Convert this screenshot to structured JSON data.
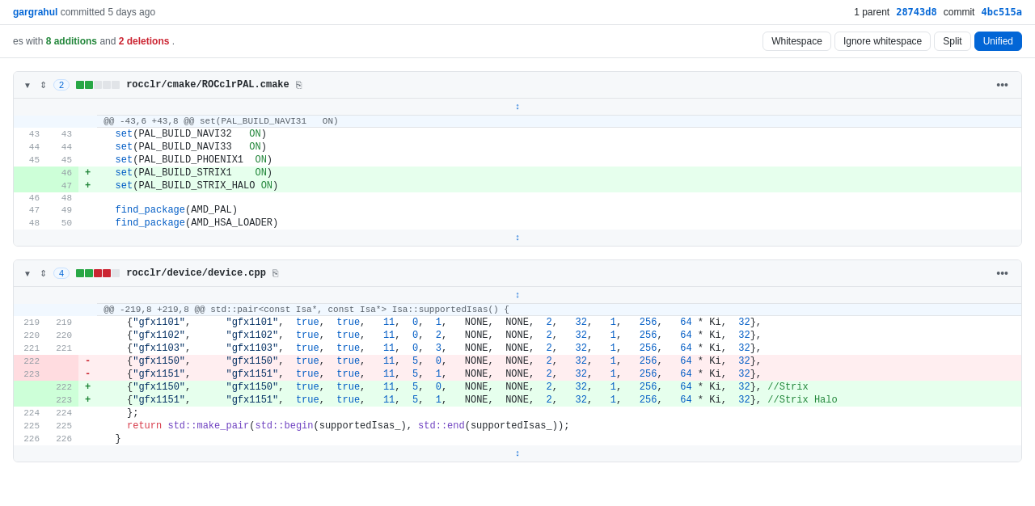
{
  "header": {
    "user": "gargrahul",
    "action": "committed",
    "time": "5 days ago",
    "parent_label": "1 parent",
    "parent_hash": "28743d8",
    "commit_label": "commit",
    "commit_hash": "4bc515a"
  },
  "stats": {
    "text": "es with",
    "additions": "8 additions",
    "and": "and",
    "deletions": "2 deletions",
    "period": "."
  },
  "view_buttons": {
    "whitespace": "Whitespace",
    "ignore_whitespace": "Ignore whitespace",
    "split": "Split",
    "unified": "Unified"
  },
  "files": [
    {
      "id": "file1",
      "diff_count": "2",
      "path": "rocclr/cmake/ROCclrPAL.cmake",
      "hunk_header": "@@ -43,6 +43,8 @@ set(PAL_BUILD_NAVI31   ON)",
      "lines": [
        {
          "type": "context",
          "old": "43",
          "new": "43",
          "sign": "",
          "content": "  set(PAL_BUILD_NAVI32   ON)"
        },
        {
          "type": "context",
          "old": "44",
          "new": "44",
          "sign": "",
          "content": "  set(PAL_BUILD_NAVI33   ON)"
        },
        {
          "type": "context",
          "old": "45",
          "new": "45",
          "sign": "",
          "content": "  set(PAL_BUILD_PHOENIX1  ON)"
        },
        {
          "type": "added",
          "old": "",
          "new": "46",
          "sign": "+",
          "content": "  set(PAL_BUILD_STRIX1    ON)"
        },
        {
          "type": "added",
          "old": "",
          "new": "47",
          "sign": "+",
          "content": "  set(PAL_BUILD_STRIX_HALO ON)"
        },
        {
          "type": "context",
          "old": "46",
          "new": "48",
          "sign": "",
          "content": ""
        },
        {
          "type": "context",
          "old": "47",
          "new": "49",
          "sign": "",
          "content": "  find_package(AMD_PAL)"
        },
        {
          "type": "context",
          "old": "48",
          "new": "50",
          "sign": "",
          "content": "  find_package(AMD_HSA_LOADER)"
        }
      ]
    },
    {
      "id": "file2",
      "diff_count": "4",
      "path": "rocclr/device/device.cpp",
      "hunk_header": "@@ -219,8 +219,8 @@ std::pair<const Isa*, const Isa*> Isa::supportedIsas() {",
      "lines": [
        {
          "type": "context",
          "old": "219",
          "new": "219",
          "sign": "",
          "content": "    {\"gfx1101\",      \"gfx1101\",  true,  true,   11,  0,  1,   NONE,  NONE,  2,   32,   1,   256,   64 * Ki,  32},"
        },
        {
          "type": "context",
          "old": "220",
          "new": "220",
          "sign": "",
          "content": "    {\"gfx1102\",      \"gfx1102\",  true,  true,   11,  0,  2,   NONE,  NONE,  2,   32,   1,   256,   64 * Ki,  32},"
        },
        {
          "type": "context",
          "old": "221",
          "new": "221",
          "sign": "",
          "content": "    {\"gfx1103\",      \"gfx1103\",  true,  true,   11,  0,  3,   NONE,  NONE,  2,   32,   1,   256,   64 * Ki,  32},"
        },
        {
          "type": "removed",
          "old": "222",
          "new": "",
          "sign": "-",
          "content": "    {\"gfx1150\",      \"gfx1150\",  true,  true,   11,  5,  0,   NONE,  NONE,  2,   32,   1,   256,   64 * Ki,  32},"
        },
        {
          "type": "removed",
          "old": "223",
          "new": "",
          "sign": "-",
          "content": "    {\"gfx1151\",      \"gfx1151\",  true,  true,   11,  5,  1,   NONE,  NONE,  2,   32,   1,   256,   64 * Ki,  32},"
        },
        {
          "type": "added",
          "old": "",
          "new": "222",
          "sign": "+",
          "content": "    {\"gfx1150\",      \"gfx1150\",  true,  true,   11,  5,  0,   NONE,  NONE,  2,   32,   1,   256,   64 * Ki,  32}, //Strix"
        },
        {
          "type": "added",
          "old": "",
          "new": "223",
          "sign": "+",
          "content": "    {\"gfx1151\",      \"gfx1151\",  true,  true,   11,  5,  1,   NONE,  NONE,  2,   32,   1,   256,   64 * Ki,  32}, //Strix Halo"
        },
        {
          "type": "context",
          "old": "224",
          "new": "224",
          "sign": "",
          "content": "    };"
        },
        {
          "type": "context",
          "old": "225",
          "new": "225",
          "sign": "",
          "content": "    return std::make_pair(std::begin(supportedIsas_), std::end(supportedIsas_));"
        },
        {
          "type": "context",
          "old": "226",
          "new": "226",
          "sign": "",
          "content": "  }"
        }
      ]
    }
  ],
  "colors": {
    "added_bg": "#e6ffed",
    "added_num_bg": "#cdffd8",
    "removed_bg": "#ffeef0",
    "removed_num_bg": "#ffdce0",
    "block1_colors": [
      "#28a745",
      "#28a745",
      "#e1e4e8",
      "#e1e4e8",
      "#e1e4e8"
    ],
    "block2_colors": [
      "#28a745",
      "#28a745",
      "#cb2431",
      "#cb2431",
      "#e1e4e8"
    ]
  }
}
